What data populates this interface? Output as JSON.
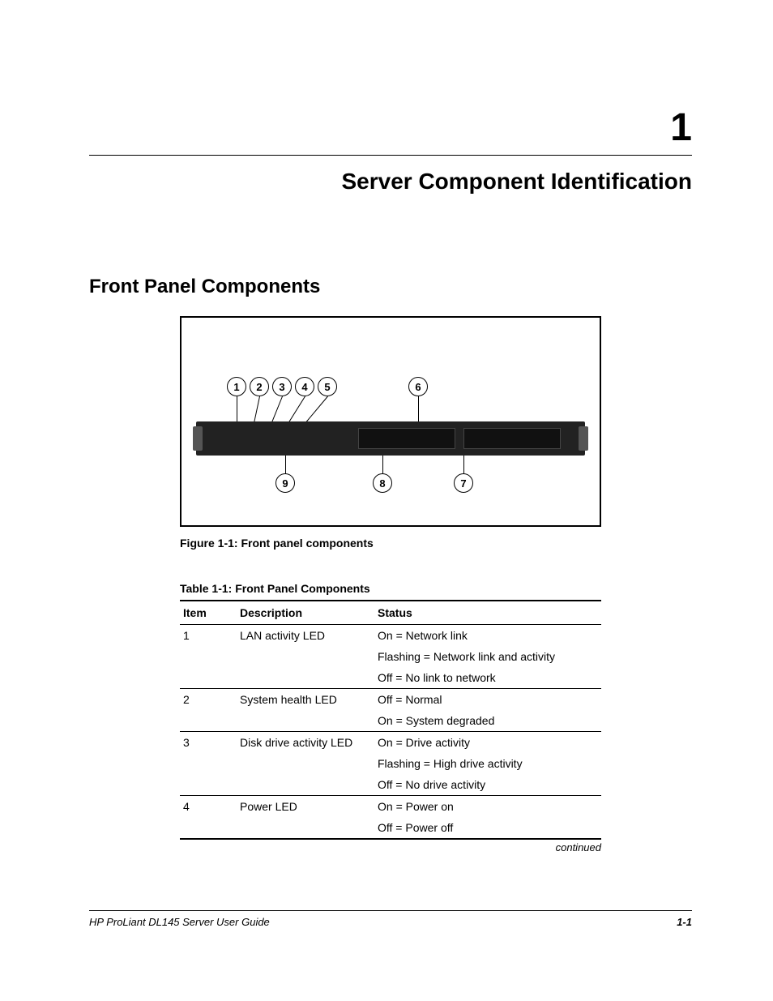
{
  "chapter": {
    "number": "1",
    "title": "Server Component Identification"
  },
  "section": {
    "title": "Front Panel Components"
  },
  "figure": {
    "caption": "Figure 1-1:  Front panel components",
    "callouts": [
      "1",
      "2",
      "3",
      "4",
      "5",
      "6",
      "7",
      "8",
      "9"
    ]
  },
  "table": {
    "title": "Table 1-1:  Front Panel Components",
    "headers": {
      "item": "Item",
      "description": "Description",
      "status": "Status"
    },
    "rows": [
      {
        "item": "1",
        "description": "LAN activity LED",
        "statuses": [
          "On = Network link",
          "Flashing = Network link and activity",
          "Off = No link to network"
        ]
      },
      {
        "item": "2",
        "description": "System health LED",
        "statuses": [
          "Off = Normal",
          "On = System degraded"
        ]
      },
      {
        "item": "3",
        "description": "Disk drive activity LED",
        "statuses": [
          "On = Drive activity",
          "Flashing = High drive activity",
          "Off = No drive activity"
        ]
      },
      {
        "item": "4",
        "description": "Power LED",
        "statuses": [
          "On = Power on",
          "Off = Power off"
        ]
      }
    ],
    "continued": "continued"
  },
  "footer": {
    "guide": "HP ProLiant DL145 Server User Guide",
    "page": "1-1"
  }
}
